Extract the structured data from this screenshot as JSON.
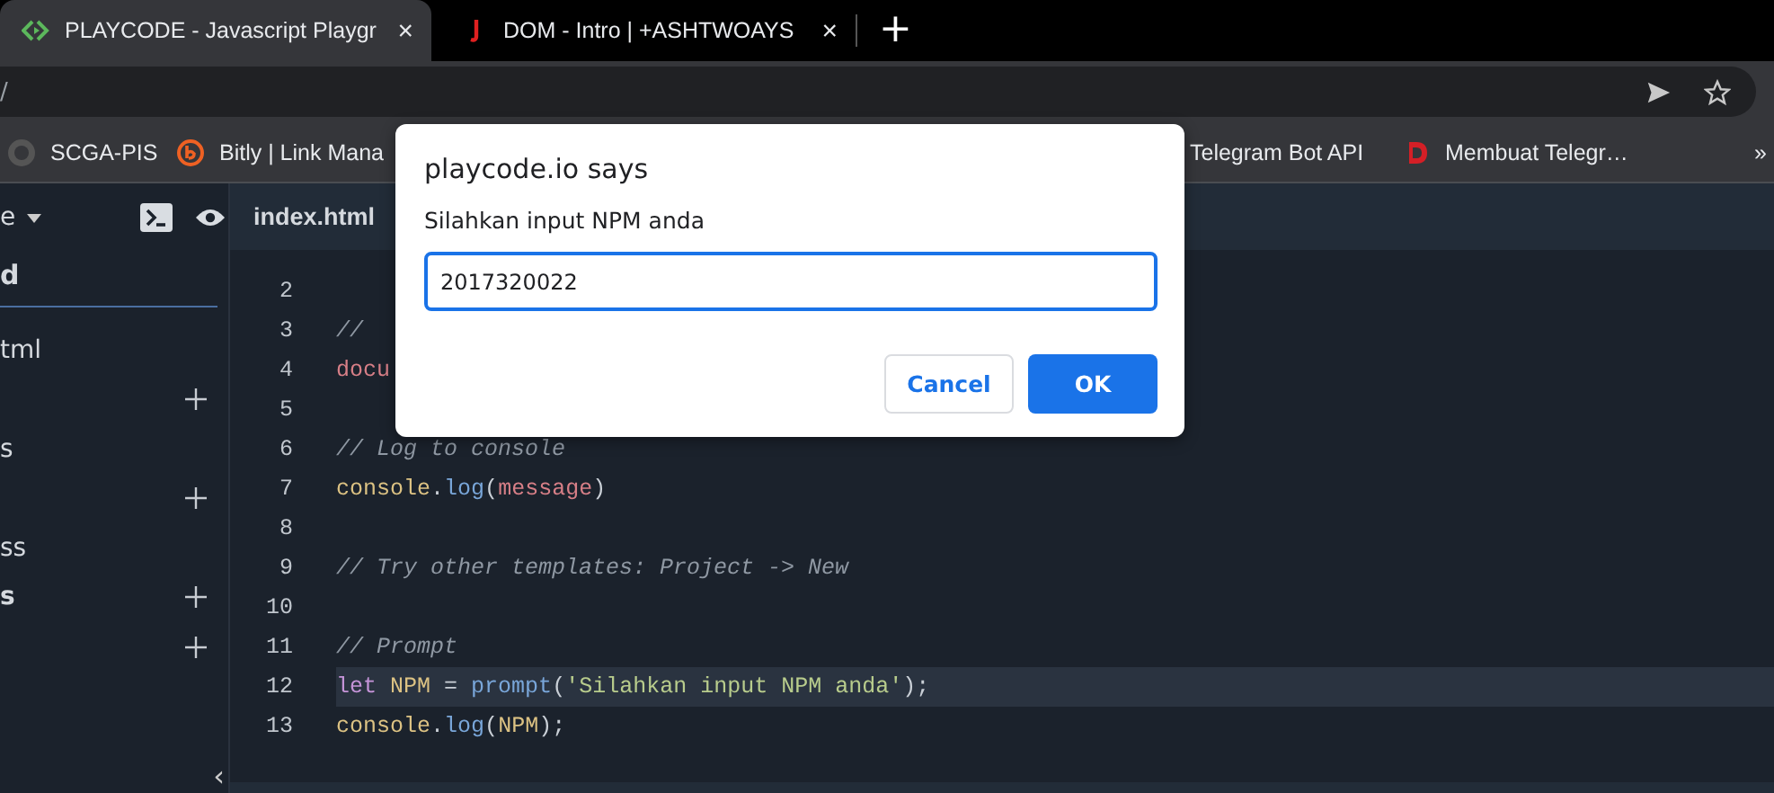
{
  "browser": {
    "tabs": [
      {
        "title": "PLAYCODE - Javascript Playgr",
        "selected": true,
        "close": "×"
      },
      {
        "title": "DOM - Intro | +ASHTWOAYS",
        "selected": false,
        "close": "×"
      }
    ],
    "new_tab": "+",
    "address": "/",
    "bookmarks": [
      {
        "label": "SCGA-PIS"
      },
      {
        "label": "Bitly | Link Mana"
      },
      {
        "label": "Telegram Bot API"
      },
      {
        "label": "Membuat Telegr…"
      }
    ],
    "more_bookmarks": "»"
  },
  "sidebar": {
    "header": "e",
    "section": "d",
    "rows": [
      {
        "kind": "file",
        "text": "tml"
      },
      {
        "kind": "add"
      },
      {
        "kind": "file",
        "text": "s"
      },
      {
        "kind": "add"
      },
      {
        "kind": "file",
        "text": "ss"
      },
      {
        "kind": "section",
        "text": "s"
      },
      {
        "kind": "add"
      }
    ],
    "collapse": "‹"
  },
  "editor": {
    "tab": "index.html",
    "lines": [
      {
        "number": "2",
        "current": false
      },
      {
        "number": "3",
        "current": false,
        "tokens": [
          {
            "kind": "comment",
            "text": "// "
          }
        ]
      },
      {
        "number": "4",
        "current": false,
        "tokens": [
          {
            "kind": "var",
            "text": "docu"
          }
        ]
      },
      {
        "number": "5",
        "current": false
      },
      {
        "number": "6",
        "current": false,
        "tokens": [
          {
            "kind": "comment",
            "text": "// Log to console"
          }
        ]
      },
      {
        "number": "7",
        "current": false,
        "tokens": [
          {
            "kind": "object",
            "text": "console"
          },
          {
            "kind": "punct",
            "text": "."
          },
          {
            "kind": "func",
            "text": "log"
          },
          {
            "kind": "punct",
            "text": "("
          },
          {
            "kind": "var",
            "text": "message"
          },
          {
            "kind": "punct",
            "text": ")"
          }
        ]
      },
      {
        "number": "8",
        "current": false
      },
      {
        "number": "9",
        "current": false,
        "tokens": [
          {
            "kind": "comment",
            "text": "// Try other templates: Project -> New"
          }
        ]
      },
      {
        "number": "10",
        "current": false
      },
      {
        "number": "11",
        "current": false,
        "tokens": [
          {
            "kind": "comment",
            "text": "// Prompt"
          }
        ]
      },
      {
        "number": "12",
        "current": true,
        "tokens": [
          {
            "kind": "keyword",
            "text": "let"
          },
          {
            "kind": "object",
            "text": " NPM"
          },
          {
            "kind": "punct",
            "text": " = "
          },
          {
            "kind": "func",
            "text": "prompt"
          },
          {
            "kind": "punct",
            "text": "("
          },
          {
            "kind": "string",
            "text": "'Silahkan input NPM anda'"
          },
          {
            "kind": "punct",
            "text": ");"
          }
        ]
      },
      {
        "number": "13",
        "current": false,
        "tokens": [
          {
            "kind": "object",
            "text": "console"
          },
          {
            "kind": "punct",
            "text": "."
          },
          {
            "kind": "func",
            "text": "log"
          },
          {
            "kind": "punct",
            "text": "("
          },
          {
            "kind": "object",
            "text": "NPM"
          },
          {
            "kind": "punct",
            "text": ");"
          }
        ]
      }
    ]
  },
  "dialog": {
    "title": "playcode.io says",
    "message": "Silahkan input NPM anda",
    "value": "2017320022",
    "buttons": [
      {
        "label": "Cancel",
        "kind": "secondary"
      },
      {
        "label": "OK",
        "kind": "primary"
      }
    ]
  }
}
